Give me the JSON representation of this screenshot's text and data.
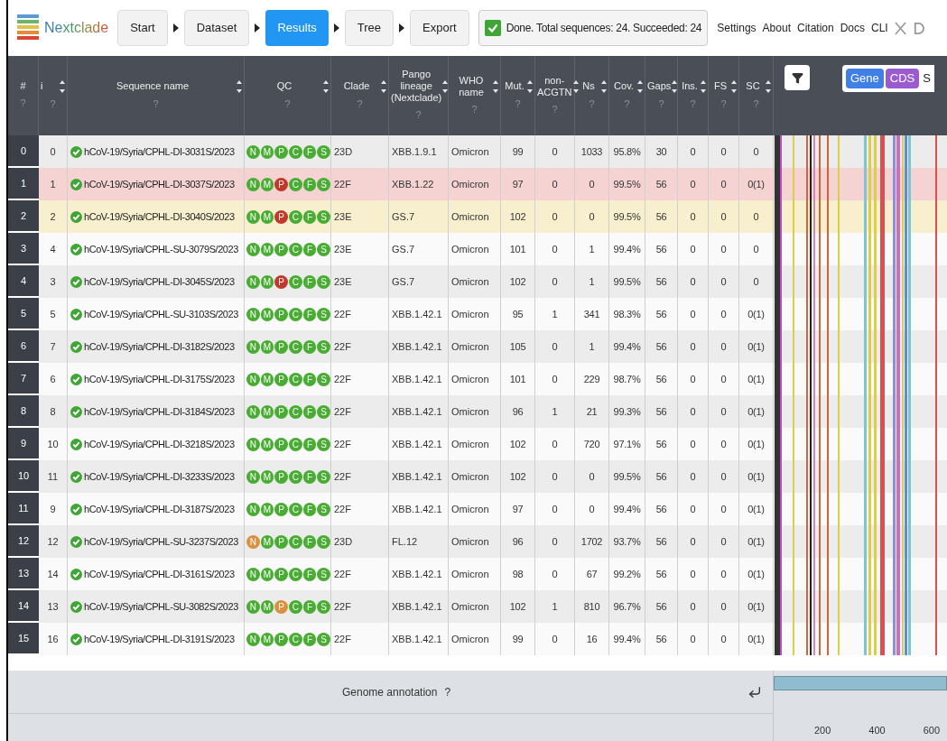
{
  "nav": {
    "app_name": "Nextclade",
    "steps": [
      {
        "label": "Start",
        "selected": false
      },
      {
        "label": "Dataset",
        "selected": false
      },
      {
        "label": "Results",
        "selected": true
      },
      {
        "label": "Tree",
        "selected": false
      },
      {
        "label": "Export",
        "selected": false
      }
    ],
    "status": {
      "text": "Done. Total sequences: 24. Succeeded: 24",
      "done": true
    },
    "links": [
      "Settings",
      "About",
      "Citation",
      "Docs",
      "CLI"
    ]
  },
  "table": {
    "columns": [
      {
        "label": "#",
        "sortable": false,
        "help": "?"
      },
      {
        "label": "i",
        "sortable": true,
        "help": "?"
      },
      {
        "label": "Sequence name",
        "sortable": true,
        "help": "?"
      },
      {
        "label": "QC",
        "sortable": true,
        "help": "?"
      },
      {
        "label": "Clade",
        "sortable": true,
        "help": "?"
      },
      {
        "label": "Pango lineage (Nextclade)",
        "sortable": true,
        "help": "?"
      },
      {
        "label": "WHO name",
        "sortable": true,
        "help": "?"
      },
      {
        "label": "Mut.",
        "sortable": true,
        "help": "?"
      },
      {
        "label": "non-ACGTN",
        "sortable": true,
        "help": "?"
      },
      {
        "label": "Ns",
        "sortable": true,
        "help": "?"
      },
      {
        "label": "Cov.",
        "sortable": true,
        "help": "?"
      },
      {
        "label": "Gaps",
        "sortable": true,
        "help": "?"
      },
      {
        "label": "Ins.",
        "sortable": true,
        "help": "?"
      },
      {
        "label": "FS",
        "sortable": true,
        "help": "?"
      },
      {
        "label": "SC",
        "sortable": true,
        "help": "?"
      }
    ],
    "rows": [
      {
        "color": "#ececec",
        "index": "0",
        "i": "0",
        "name": "hCoV-19/Syria/CPHL-DI-3031S/2023",
        "qc": [
          {
            "letter": "N",
            "color": "#49ad33"
          },
          {
            "letter": "M",
            "color": "#49ad33"
          },
          {
            "letter": "P",
            "color": "#49ad33"
          },
          {
            "letter": "C",
            "color": "#49ad33"
          },
          {
            "letter": "F",
            "color": "#49ad33"
          },
          {
            "letter": "S",
            "color": "#49ad33"
          }
        ],
        "clade": "23D",
        "pango": "XBB.1.9.1",
        "who": "Omicron",
        "mut": "99",
        "non_acgtn": "0",
        "ns": "1033",
        "cov": "95.8%",
        "gaps": "30",
        "ins": "0",
        "fs": "0",
        "sc": "0"
      },
      {
        "color": "#f5d3d3",
        "index": "1",
        "i": "1",
        "name": "hCoV-19/Syria/CPHL-DI-3037S/2023",
        "qc": [
          {
            "letter": "N",
            "color": "#49ad33"
          },
          {
            "letter": "M",
            "color": "#49ad33"
          },
          {
            "letter": "P",
            "color": "#c0392b"
          },
          {
            "letter": "C",
            "color": "#49ad33"
          },
          {
            "letter": "F",
            "color": "#49ad33"
          },
          {
            "letter": "S",
            "color": "#49ad33"
          }
        ],
        "clade": "22F",
        "pango": "XBB.1.22",
        "who": "Omicron",
        "mut": "97",
        "non_acgtn": "0",
        "ns": "0",
        "cov": "99.5%",
        "gaps": "56",
        "ins": "0",
        "fs": "0",
        "sc": "0(1)"
      },
      {
        "color": "#f7efcd",
        "index": "2",
        "i": "2",
        "name": "hCoV-19/Syria/CPHL-DI-3040S/2023",
        "qc": [
          {
            "letter": "N",
            "color": "#49ad33"
          },
          {
            "letter": "M",
            "color": "#49ad33"
          },
          {
            "letter": "P",
            "color": "#c0392b"
          },
          {
            "letter": "C",
            "color": "#49ad33"
          },
          {
            "letter": "F",
            "color": "#49ad33"
          },
          {
            "letter": "S",
            "color": "#49ad33"
          }
        ],
        "clade": "23E",
        "pango": "GS.7",
        "who": "Omicron",
        "mut": "102",
        "non_acgtn": "0",
        "ns": "0",
        "cov": "99.5%",
        "gaps": "56",
        "ins": "0",
        "fs": "0",
        "sc": "0"
      },
      {
        "color": "#fafafa",
        "index": "3",
        "i": "4",
        "name": "hCoV-19/Syria/CPHL-SU-3079S/2023",
        "qc": [
          {
            "letter": "N",
            "color": "#49ad33"
          },
          {
            "letter": "M",
            "color": "#49ad33"
          },
          {
            "letter": "P",
            "color": "#49ad33"
          },
          {
            "letter": "C",
            "color": "#49ad33"
          },
          {
            "letter": "F",
            "color": "#49ad33"
          },
          {
            "letter": "S",
            "color": "#49ad33"
          }
        ],
        "clade": "23E",
        "pango": "GS.7",
        "who": "Omicron",
        "mut": "101",
        "non_acgtn": "0",
        "ns": "1",
        "cov": "99.4%",
        "gaps": "56",
        "ins": "0",
        "fs": "0",
        "sc": "0"
      },
      {
        "color": "#ececec",
        "index": "4",
        "i": "3",
        "name": "hCoV-19/Syria/CPHL-DI-3045S/2023",
        "qc": [
          {
            "letter": "N",
            "color": "#49ad33"
          },
          {
            "letter": "M",
            "color": "#49ad33"
          },
          {
            "letter": "P",
            "color": "#c0392b"
          },
          {
            "letter": "C",
            "color": "#49ad33"
          },
          {
            "letter": "F",
            "color": "#49ad33"
          },
          {
            "letter": "S",
            "color": "#49ad33"
          }
        ],
        "clade": "23E",
        "pango": "GS.7",
        "who": "Omicron",
        "mut": "102",
        "non_acgtn": "0",
        "ns": "1",
        "cov": "99.5%",
        "gaps": "56",
        "ins": "0",
        "fs": "0",
        "sc": "0"
      },
      {
        "color": "#fafafa",
        "index": "5",
        "i": "5",
        "name": "hCoV-19/Syria/CPHL-SU-3103S/2023",
        "qc": [
          {
            "letter": "N",
            "color": "#49ad33"
          },
          {
            "letter": "M",
            "color": "#49ad33"
          },
          {
            "letter": "P",
            "color": "#49ad33"
          },
          {
            "letter": "C",
            "color": "#49ad33"
          },
          {
            "letter": "F",
            "color": "#49ad33"
          },
          {
            "letter": "S",
            "color": "#49ad33"
          }
        ],
        "clade": "22F",
        "pango": "XBB.1.42.1",
        "who": "Omicron",
        "mut": "95",
        "non_acgtn": "1",
        "ns": "341",
        "cov": "98.3%",
        "gaps": "56",
        "ins": "0",
        "fs": "0",
        "sc": "0(1)"
      },
      {
        "color": "#ececec",
        "index": "6",
        "i": "7",
        "name": "hCoV-19/Syria/CPHL-DI-3182S/2023",
        "qc": [
          {
            "letter": "N",
            "color": "#49ad33"
          },
          {
            "letter": "M",
            "color": "#49ad33"
          },
          {
            "letter": "P",
            "color": "#49ad33"
          },
          {
            "letter": "C",
            "color": "#49ad33"
          },
          {
            "letter": "F",
            "color": "#49ad33"
          },
          {
            "letter": "S",
            "color": "#49ad33"
          }
        ],
        "clade": "22F",
        "pango": "XBB.1.42.1",
        "who": "Omicron",
        "mut": "105",
        "non_acgtn": "0",
        "ns": "1",
        "cov": "99.4%",
        "gaps": "56",
        "ins": "0",
        "fs": "0",
        "sc": "0(1)"
      },
      {
        "color": "#fafafa",
        "index": "7",
        "i": "6",
        "name": "hCoV-19/Syria/CPHL-DI-3175S/2023",
        "qc": [
          {
            "letter": "N",
            "color": "#49ad33"
          },
          {
            "letter": "M",
            "color": "#49ad33"
          },
          {
            "letter": "P",
            "color": "#49ad33"
          },
          {
            "letter": "C",
            "color": "#49ad33"
          },
          {
            "letter": "F",
            "color": "#49ad33"
          },
          {
            "letter": "S",
            "color": "#49ad33"
          }
        ],
        "clade": "22F",
        "pango": "XBB.1.42.1",
        "who": "Omicron",
        "mut": "101",
        "non_acgtn": "0",
        "ns": "229",
        "cov": "98.7%",
        "gaps": "56",
        "ins": "0",
        "fs": "0",
        "sc": "0(1)"
      },
      {
        "color": "#ececec",
        "index": "8",
        "i": "8",
        "name": "hCoV-19/Syria/CPHL-DI-3184S/2023",
        "qc": [
          {
            "letter": "N",
            "color": "#49ad33"
          },
          {
            "letter": "M",
            "color": "#49ad33"
          },
          {
            "letter": "P",
            "color": "#49ad33"
          },
          {
            "letter": "C",
            "color": "#49ad33"
          },
          {
            "letter": "F",
            "color": "#49ad33"
          },
          {
            "letter": "S",
            "color": "#49ad33"
          }
        ],
        "clade": "22F",
        "pango": "XBB.1.42.1",
        "who": "Omicron",
        "mut": "96",
        "non_acgtn": "1",
        "ns": "21",
        "cov": "99.3%",
        "gaps": "56",
        "ins": "0",
        "fs": "0",
        "sc": "0(1)"
      },
      {
        "color": "#fafafa",
        "index": "9",
        "i": "10",
        "name": "hCoV-19/Syria/CPHL-DI-3218S/2023",
        "qc": [
          {
            "letter": "N",
            "color": "#49ad33"
          },
          {
            "letter": "M",
            "color": "#49ad33"
          },
          {
            "letter": "P",
            "color": "#49ad33"
          },
          {
            "letter": "C",
            "color": "#49ad33"
          },
          {
            "letter": "F",
            "color": "#49ad33"
          },
          {
            "letter": "S",
            "color": "#49ad33"
          }
        ],
        "clade": "22F",
        "pango": "XBB.1.42.1",
        "who": "Omicron",
        "mut": "102",
        "non_acgtn": "0",
        "ns": "720",
        "cov": "97.1%",
        "gaps": "56",
        "ins": "0",
        "fs": "0",
        "sc": "0(1)"
      },
      {
        "color": "#ececec",
        "index": "10",
        "i": "11",
        "name": "hCoV-19/Syria/CPHL-DI-3233S/2023",
        "qc": [
          {
            "letter": "N",
            "color": "#49ad33"
          },
          {
            "letter": "M",
            "color": "#49ad33"
          },
          {
            "letter": "P",
            "color": "#49ad33"
          },
          {
            "letter": "C",
            "color": "#49ad33"
          },
          {
            "letter": "F",
            "color": "#49ad33"
          },
          {
            "letter": "S",
            "color": "#49ad33"
          }
        ],
        "clade": "22F",
        "pango": "XBB.1.42.1",
        "who": "Omicron",
        "mut": "102",
        "non_acgtn": "0",
        "ns": "0",
        "cov": "99.5%",
        "gaps": "56",
        "ins": "0",
        "fs": "0",
        "sc": "0(1)"
      },
      {
        "color": "#fafafa",
        "index": "11",
        "i": "9",
        "name": "hCoV-19/Syria/CPHL-DI-3187S/2023",
        "qc": [
          {
            "letter": "N",
            "color": "#49ad33"
          },
          {
            "letter": "M",
            "color": "#49ad33"
          },
          {
            "letter": "P",
            "color": "#49ad33"
          },
          {
            "letter": "C",
            "color": "#49ad33"
          },
          {
            "letter": "F",
            "color": "#49ad33"
          },
          {
            "letter": "S",
            "color": "#49ad33"
          }
        ],
        "clade": "22F",
        "pango": "XBB.1.42.1",
        "who": "Omicron",
        "mut": "97",
        "non_acgtn": "0",
        "ns": "0",
        "cov": "99.4%",
        "gaps": "56",
        "ins": "0",
        "fs": "0",
        "sc": "0(1)"
      },
      {
        "color": "#ececec",
        "index": "12",
        "i": "12",
        "name": "hCoV-19/Syria/CPHL-SU-3237S/2023",
        "qc": [
          {
            "letter": "N",
            "color": "#d9913f"
          },
          {
            "letter": "M",
            "color": "#49ad33"
          },
          {
            "letter": "P",
            "color": "#49ad33"
          },
          {
            "letter": "C",
            "color": "#49ad33"
          },
          {
            "letter": "F",
            "color": "#49ad33"
          },
          {
            "letter": "S",
            "color": "#49ad33"
          }
        ],
        "clade": "23D",
        "pango": "FL.12",
        "who": "Omicron",
        "mut": "96",
        "non_acgtn": "0",
        "ns": "1702",
        "cov": "93.7%",
        "gaps": "56",
        "ins": "0",
        "fs": "0",
        "sc": "0(1)"
      },
      {
        "color": "#fafafa",
        "index": "13",
        "i": "14",
        "name": "hCoV-19/Syria/CPHL-DI-3161S/2023",
        "qc": [
          {
            "letter": "N",
            "color": "#49ad33"
          },
          {
            "letter": "M",
            "color": "#49ad33"
          },
          {
            "letter": "P",
            "color": "#49ad33"
          },
          {
            "letter": "C",
            "color": "#49ad33"
          },
          {
            "letter": "F",
            "color": "#49ad33"
          },
          {
            "letter": "S",
            "color": "#49ad33"
          }
        ],
        "clade": "22F",
        "pango": "XBB.1.42.1",
        "who": "Omicron",
        "mut": "98",
        "non_acgtn": "0",
        "ns": "67",
        "cov": "99.2%",
        "gaps": "56",
        "ins": "0",
        "fs": "0",
        "sc": "0(1)"
      },
      {
        "color": "#ececec",
        "index": "14",
        "i": "13",
        "name": "hCoV-19/Syria/CPHL-SU-3082S/2023",
        "qc": [
          {
            "letter": "N",
            "color": "#49ad33"
          },
          {
            "letter": "M",
            "color": "#49ad33"
          },
          {
            "letter": "P",
            "color": "#d9913f"
          },
          {
            "letter": "C",
            "color": "#49ad33"
          },
          {
            "letter": "F",
            "color": "#49ad33"
          },
          {
            "letter": "S",
            "color": "#49ad33"
          }
        ],
        "clade": "22F",
        "pango": "XBB.1.42.1",
        "who": "Omicron",
        "mut": "102",
        "non_acgtn": "1",
        "ns": "810",
        "cov": "96.7%",
        "gaps": "56",
        "ins": "0",
        "fs": "0",
        "sc": "0(1)"
      },
      {
        "color": "#fafafa",
        "index": "15",
        "i": "16",
        "name": "hCoV-19/Syria/CPHL-DI-3191S/2023",
        "qc": [
          {
            "letter": "N",
            "color": "#49ad33"
          },
          {
            "letter": "M",
            "color": "#49ad33"
          },
          {
            "letter": "P",
            "color": "#49ad33"
          },
          {
            "letter": "C",
            "color": "#49ad33"
          },
          {
            "letter": "F",
            "color": "#49ad33"
          },
          {
            "letter": "S",
            "color": "#49ad33"
          }
        ],
        "clade": "22F",
        "pango": "XBB.1.42.1",
        "who": "Omicron",
        "mut": "99",
        "non_acgtn": "0",
        "ns": "16",
        "cov": "99.4%",
        "gaps": "56",
        "ins": "0",
        "fs": "0",
        "sc": "0(1)"
      }
    ]
  },
  "sequence_view": {
    "buttons": [
      {
        "label": "Gene",
        "color": "#3f7fe6"
      },
      {
        "label": "CDS",
        "color": "#9a5bd1"
      }
    ],
    "cut_text": "S"
  },
  "footer": {
    "title": "Genome annotation",
    "help": "?",
    "axis_ticks": [
      "200",
      "400",
      "600"
    ]
  }
}
